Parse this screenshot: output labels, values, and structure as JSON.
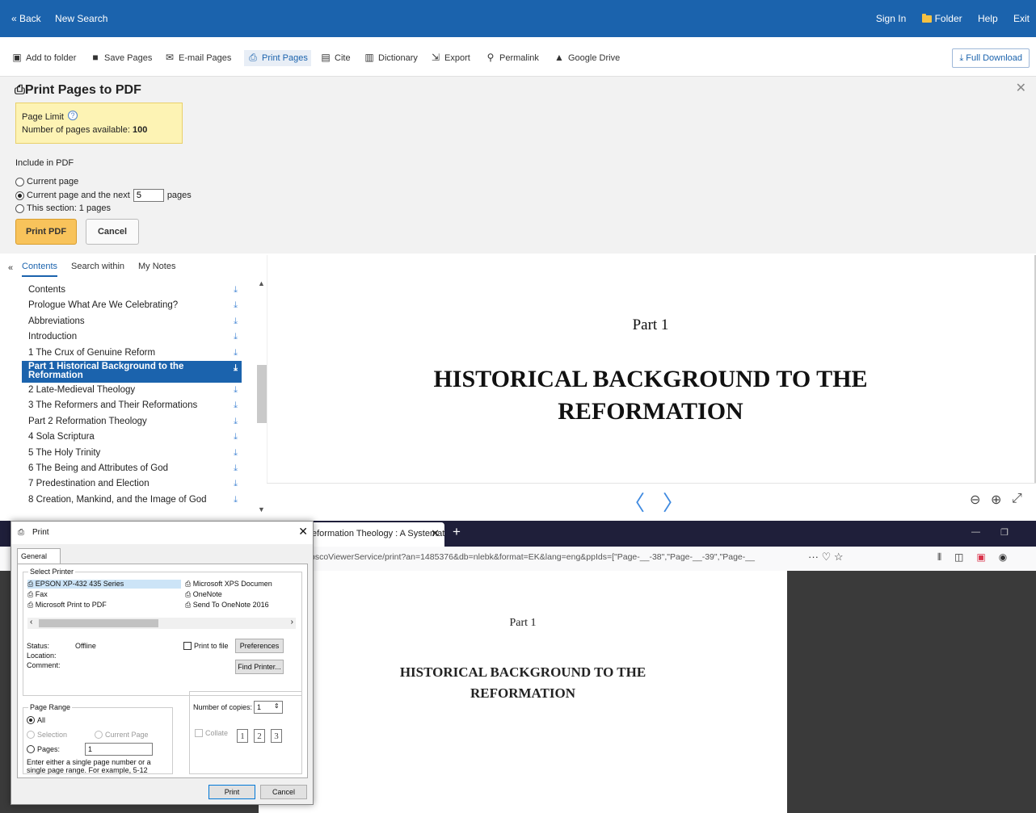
{
  "topbar": {
    "back": "« Back",
    "new_search": "New Search",
    "sign_in": "Sign In",
    "folder": "Folder",
    "help": "Help",
    "exit": "Exit"
  },
  "toolbar": {
    "add_to_folder": "Add to folder",
    "save_pages": "Save Pages",
    "email_pages": "E-mail Pages",
    "print_pages": "Print Pages",
    "cite": "Cite",
    "dictionary": "Dictionary",
    "export": "Export",
    "permalink": "Permalink",
    "google_drive": "Google Drive",
    "full_download": "Full Download"
  },
  "print_panel": {
    "title": "Print Pages to PDF",
    "page_limit_label": "Page Limit",
    "pages_available_label": "Number of pages available:",
    "pages_available_value": "100",
    "include_label": "Include in PDF",
    "opt_current": "Current page",
    "opt_next_prefix": "Current page and the next",
    "opt_next_value": "5",
    "opt_next_suffix": "pages",
    "opt_section": "This section: 1 pages",
    "print_btn": "Print PDF",
    "cancel_btn": "Cancel"
  },
  "viewer": {
    "tabs": [
      "Contents",
      "Search within",
      "My Notes"
    ],
    "toc": [
      "Contents",
      "Prologue What Are We Celebrating?",
      "Abbreviations",
      "Introduction",
      "1 The Crux of Genuine Reform",
      "Part 1 Historical Background to the Reformation",
      "2 Late-Medieval Theology",
      "3 The Reformers and Their Reformations",
      "Part 2 Reformation Theology",
      "4 Sola Scriptura",
      "5 The Holy Trinity",
      "6 The Being and Attributes of God",
      "7 Predestination and Election",
      "8 Creation, Mankind, and the Image of God"
    ],
    "page_part": "Part 1",
    "page_title_line1": "HISTORICAL BACKGROUND TO THE",
    "page_title_line2": "REFORMATION"
  },
  "browser": {
    "tab_title": "eformation Theology : A Systemat",
    "url": "oscoViewerService/print?an=1485376&db=nlebk&format=EK&lang=eng&ppIds=[\"Page-__-38\",\"Page-__-39\",\"Page-__",
    "paper_part": "Part 1",
    "paper_title_line1": "HISTORICAL BACKGROUND TO THE",
    "paper_title_line2": "REFORMATION"
  },
  "print_dialog": {
    "title": "Print",
    "tab": "General",
    "select_printer": "Select Printer",
    "printers": [
      "EPSON XP-432 435 Series",
      "Microsoft XPS Documen",
      "Fax",
      "OneNote",
      "Microsoft Print to PDF",
      "Send To OneNote 2016"
    ],
    "status_label": "Status:",
    "status_value": "Offline",
    "location_label": "Location:",
    "comment_label": "Comment:",
    "print_to_file": "Print to file",
    "preferences": "Preferences",
    "find_printer": "Find Printer...",
    "page_range": "Page Range",
    "all": "All",
    "selection": "Selection",
    "current_page": "Current Page",
    "pages": "Pages:",
    "pages_value": "1",
    "hint": "Enter either a single page number or a single page range.  For example, 5-12",
    "copies_label": "Number of copies:",
    "copies_value": "1",
    "collate": "Collate",
    "print_btn": "Print",
    "cancel_btn": "Cancel"
  }
}
